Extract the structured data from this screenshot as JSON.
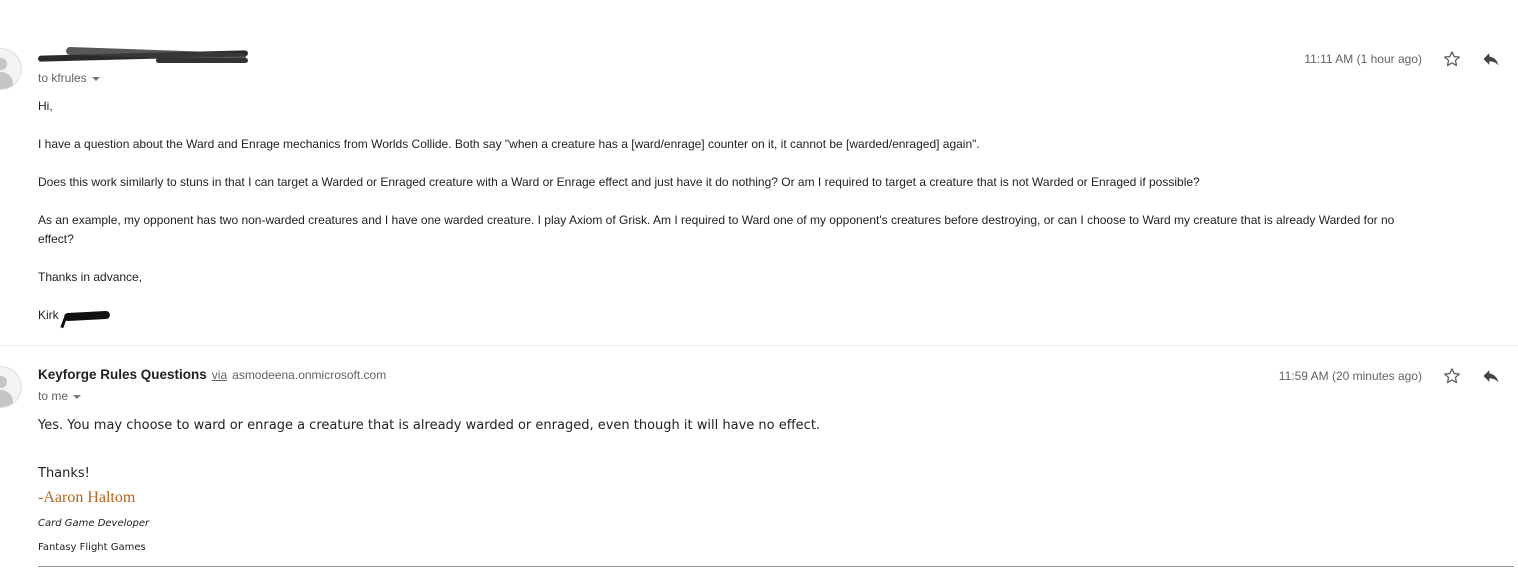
{
  "messages": [
    {
      "sender": "",
      "recipient": "to kfrules",
      "time": "11:11 AM (1 hour ago)",
      "body": {
        "greeting": "Hi,",
        "p1": "I have a question about the Ward and Enrage mechanics from Worlds Collide. Both say \"when a creature has a [ward/enrage] counter on it, it cannot be [warded/enraged] again\".",
        "p2": "Does this work similarly to stuns in that I can target a Warded or Enraged creature with a Ward or Enrage effect and just have it do nothing? Or am I required to target a creature that is not Warded or Enraged if possible?",
        "p3_line1": "As an example, my opponent has two non-warded creatures and I have one warded creature. I play Axiom of Grisk. Am I required to Ward one of my opponent's creatures before destroying, or can I choose to Ward my creature that is already Warded for no",
        "p3_line2": "effect?",
        "thanks": "Thanks in advance,",
        "signature": "Kirk"
      }
    },
    {
      "sender": "Keyforge Rules Questions",
      "via_label": "via",
      "via_domain": "asmodeena.onmicrosoft.com",
      "recipient": "to me",
      "time": "11:59 AM (20 minutes ago)",
      "body": {
        "answer": "Yes. You may choose to ward or enrage a creature that is already warded or enraged, even though it will have no effect.",
        "thanks": "Thanks!",
        "sig_name": "-Aaron Haltom",
        "sig_title": "Card Game Developer",
        "sig_company": "Fantasy Flight Games"
      }
    }
  ],
  "colors": {
    "signature_name": "#b5651d",
    "meta_text": "#5f6368"
  },
  "icons": [
    "person-icon",
    "star-icon",
    "reply-icon",
    "chevron-down-icon"
  ]
}
